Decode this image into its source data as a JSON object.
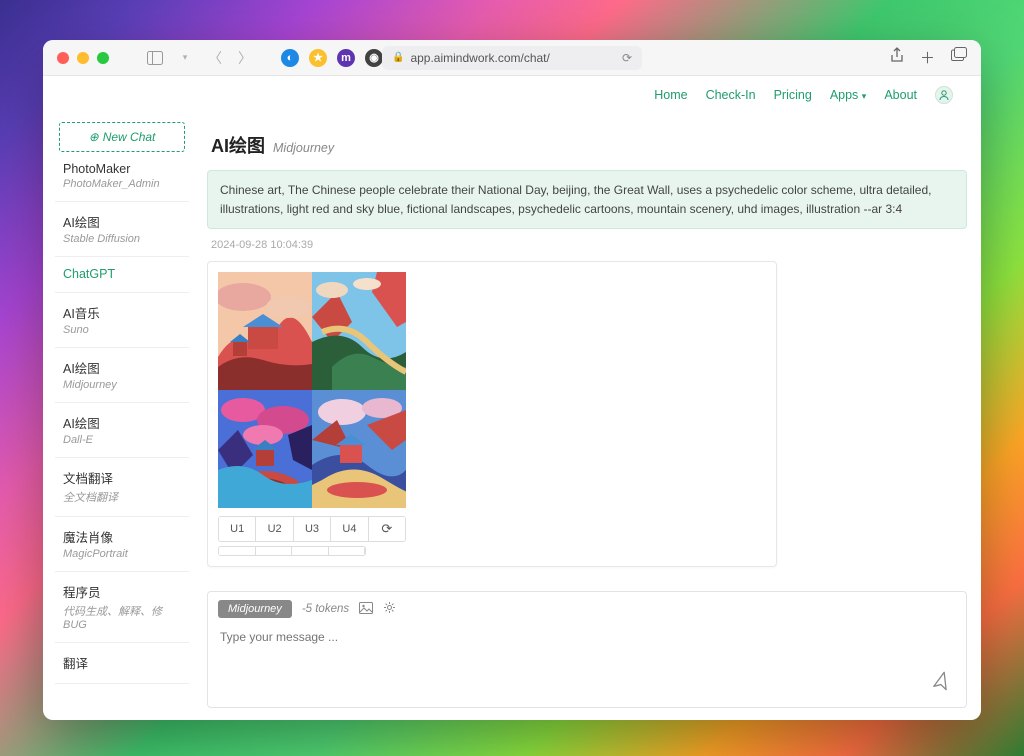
{
  "browser": {
    "url": "app.aimindwork.com/chat/"
  },
  "nav": {
    "items": [
      {
        "label": "Home"
      },
      {
        "label": "Check-In"
      },
      {
        "label": "Pricing"
      },
      {
        "label": "Apps"
      },
      {
        "label": "About"
      }
    ]
  },
  "sidebar": {
    "new_chat": "New Chat",
    "items": [
      {
        "title": "PhotoMaker",
        "sub": "PhotoMaker_Admin"
      },
      {
        "title": "AI绘图",
        "sub": "Stable Diffusion"
      },
      {
        "title": "ChatGPT",
        "sub": ""
      },
      {
        "title": "AI音乐",
        "sub": "Suno"
      },
      {
        "title": "AI绘图",
        "sub": "Midjourney"
      },
      {
        "title": "AI绘图",
        "sub": "Dall-E"
      },
      {
        "title": "文档翻译",
        "sub": "全文档翻译"
      },
      {
        "title": "魔法肖像",
        "sub": "MagicPortrait"
      },
      {
        "title": "程序员",
        "sub": "代码生成、解释、修BUG"
      },
      {
        "title": "翻译",
        "sub": ""
      }
    ]
  },
  "main": {
    "title": "AI绘图",
    "subtitle": "Midjourney",
    "user_message": "Chinese art, The Chinese people celebrate their National Day, beijing, the Great Wall, uses a psychedelic color scheme, ultra detailed, illustrations, light red and sky blue, fictional landscapes, psychedelic cartoons, mountain scenery, uhd images, illustration --ar 3:4",
    "timestamp": "2024-09-28 10:04:39",
    "buttons": {
      "u1": "U1",
      "u2": "U2",
      "u3": "U3",
      "u4": "U4",
      "refresh": "⟳"
    }
  },
  "composer": {
    "model": "Midjourney",
    "tokens": "-5 tokens",
    "placeholder": "Type your message ..."
  }
}
